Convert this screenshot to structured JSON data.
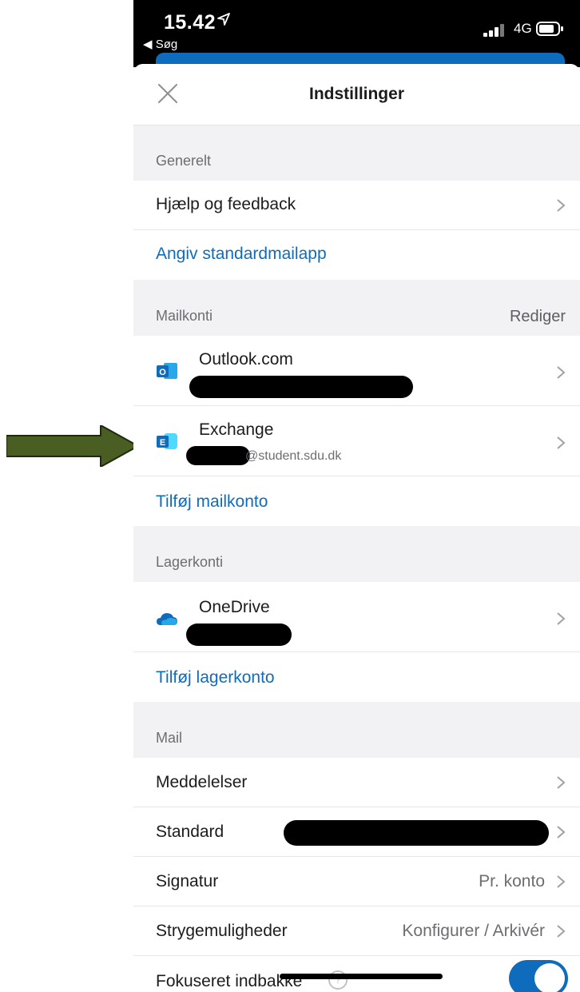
{
  "status_bar": {
    "time": "15.42",
    "back_app": "◀ Søg",
    "network": "4G"
  },
  "header": {
    "title": "Indstillinger"
  },
  "sections": {
    "general": {
      "header": "Generelt",
      "help_label": "Hjælp og feedback",
      "default_mail_link": "Angiv standardmailapp"
    },
    "mail_accounts": {
      "header": "Mailkonti",
      "edit_label": "Rediger",
      "accounts": [
        {
          "name": "Outlook.com",
          "icon": "outlook-icon",
          "email": ""
        },
        {
          "name": "Exchange",
          "icon": "exchange-icon",
          "email": "@student.sdu.dk"
        }
      ],
      "add_link": "Tilføj mailkonto"
    },
    "storage_accounts": {
      "header": "Lagerkonti",
      "accounts": [
        {
          "name": "OneDrive",
          "icon": "onedrive-icon"
        }
      ],
      "add_link": "Tilføj lagerkonto"
    },
    "mail": {
      "header": "Mail",
      "rows": [
        {
          "label": "Meddelelser",
          "value": ""
        },
        {
          "label": "Standard",
          "value": ""
        },
        {
          "label": "Signatur",
          "value": "Pr. konto"
        },
        {
          "label": "Strygemuligheder",
          "value": "Konfigurer / Arkivér"
        },
        {
          "label": "Fokuseret indbakke",
          "value": ""
        }
      ],
      "focused_inbox_enabled": true
    }
  },
  "colors": {
    "accent": "#0f6cbd",
    "annotation_arrow": "#4a5e23"
  }
}
